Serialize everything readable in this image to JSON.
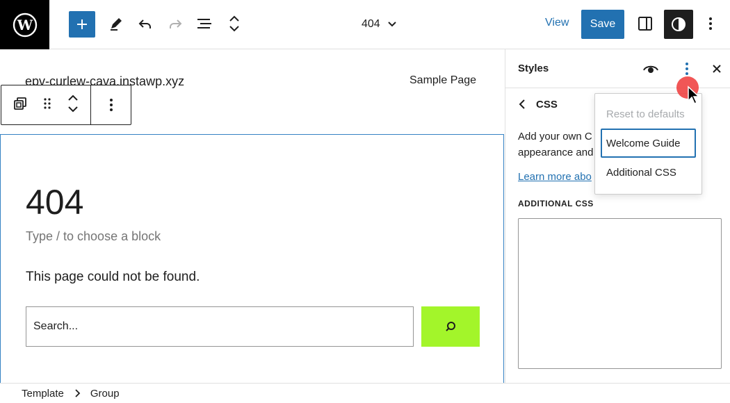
{
  "toolbar": {
    "logo_icon": "wordpress-logo",
    "document_title": "404",
    "view_label": "View",
    "save_label": "Save",
    "accent_color": "#2271b1"
  },
  "canvas": {
    "site_title": "epv-curlew-cava.instawp.xyz",
    "nav_item": "Sample Page",
    "heading": "404",
    "block_placeholder": "Type / to choose a block",
    "paragraph": "This page could not be found.",
    "search_value": "Search...",
    "search_button_color": "#a3f52a"
  },
  "sidebar": {
    "title": "Styles",
    "section_title": "CSS",
    "description": "Add your own C",
    "description_line2": "appearance and",
    "learn_more": "Learn more abo",
    "css_label": "ADDITIONAL CSS",
    "css_value": ""
  },
  "dropdown": {
    "items": [
      {
        "label": "Reset to defaults",
        "disabled": true
      },
      {
        "label": "Welcome Guide",
        "focused": true
      },
      {
        "label": "Additional CSS"
      }
    ]
  },
  "breadcrumbs": [
    "Template",
    "Group"
  ]
}
